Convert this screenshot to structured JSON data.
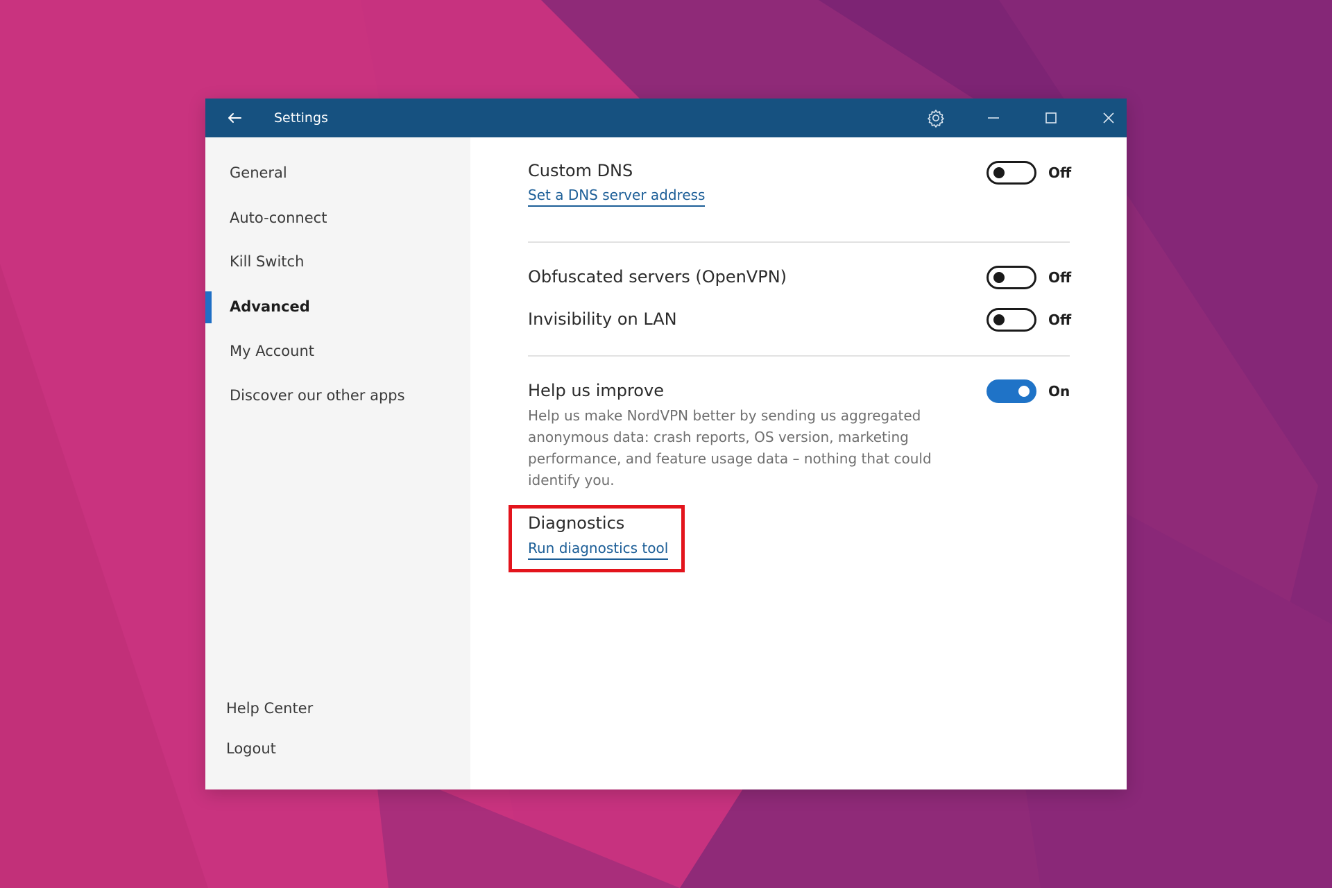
{
  "window": {
    "title": "Settings"
  },
  "titlebar": {
    "back_icon": "arrow-left-icon",
    "settings_icon": "gear-icon",
    "minimize_icon": "minimize-icon",
    "maximize_icon": "maximize-icon",
    "close_icon": "close-icon"
  },
  "sidebar": {
    "items": [
      {
        "label": "General",
        "active": false
      },
      {
        "label": "Auto-connect",
        "active": false
      },
      {
        "label": "Kill Switch",
        "active": false
      },
      {
        "label": "Advanced",
        "active": true
      },
      {
        "label": "My Account",
        "active": false
      },
      {
        "label": "Discover our other apps",
        "active": false
      }
    ],
    "footer": [
      {
        "label": "Help Center"
      },
      {
        "label": "Logout"
      }
    ]
  },
  "settings": {
    "custom_dns": {
      "title": "Custom DNS",
      "link": "Set a DNS server address",
      "state": "Off",
      "enabled": false
    },
    "obfuscated": {
      "title": "Obfuscated servers (OpenVPN)",
      "state": "Off",
      "enabled": false
    },
    "invisibility": {
      "title": "Invisibility on LAN",
      "state": "Off",
      "enabled": false
    },
    "help_improve": {
      "title": "Help us improve",
      "description": "Help us make NordVPN better by sending us aggregated anonymous data: crash reports, OS version, marketing performance, and feature usage data – nothing that could identify you.",
      "state": "On",
      "enabled": true
    },
    "diagnostics": {
      "title": "Diagnostics",
      "link": "Run diagnostics tool"
    }
  },
  "colors": {
    "titlebar": "#165180",
    "accent": "#1f73c7",
    "link": "#1c5e97",
    "highlight": "#e3141c"
  }
}
